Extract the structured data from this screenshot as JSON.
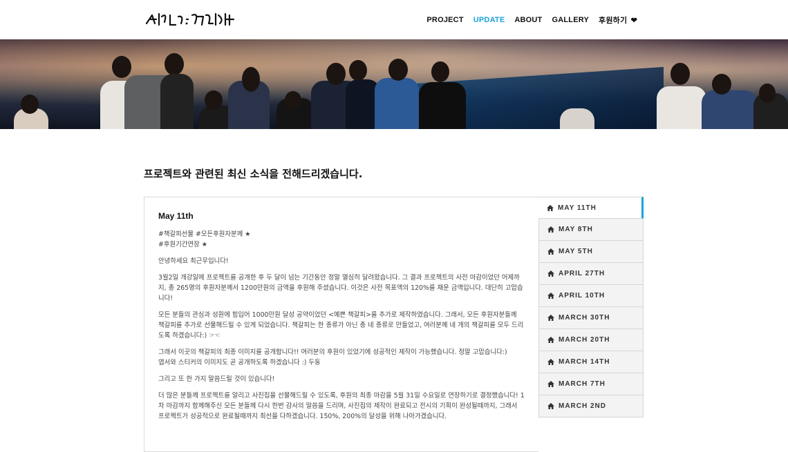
{
  "header": {
    "logo_alt": "서강대 · 고고기억해",
    "nav": [
      {
        "label": "PROJECT",
        "active": false
      },
      {
        "label": "UPDATE",
        "active": true
      },
      {
        "label": "ABOUT",
        "active": false
      },
      {
        "label": "GALLERY",
        "active": false
      },
      {
        "label": "후원하기",
        "active": false,
        "icon": "heart-icon"
      }
    ]
  },
  "page": {
    "title": "프로젝트와 관련된 최신 소식을 전해드리겠습니다."
  },
  "post": {
    "date": "May 11th",
    "paragraphs": [
      "#책갈피선물 #모든후원자분께 ★\n#후원기간연장 ★",
      "안녕하세요 최근우입니다!",
      "3월2일 개강일에 프로젝트를 공개한 후 두 달이 넘는 기간동안 정말 열심히 달려왔습니다. 그 결과 프로젝트의 사전 마감이었던 어제까지, 총 265명의 후원자분께서 1200만원의 금액을 후원해 주셨습니다. 이것은 사전 목표액의 120%를 채운 금액입니다. 대단히 고맙습니다!",
      "모든 분들의 관심과 성원에 힘입어 1000만원 달성 공약이었던 <예쁜 책갈피>를 추가로 제작하였습니다. 그래서, 모든 후원자분들께 책갈피를 추가로 선물해드릴 수 있게 되었습니다. 책갈피는 한 종류가 아닌 총 네 종류로 만들었고, 여러분께 네 개의 책갈피를 모두 드리도록 하겠습니다:) ☞☜",
      "그래서 이곳의 책갈피의 최종 이미지를 공개합니다!! 여러분의 후원이 있었기에 성공적인 제작이 가능했습니다. 정말 고맙습니다:)\n엽서와 스티커의 이미지도 곧 공개하도록 하겠습니다 :) 두둥",
      "그리고 또 한 가지 말씀드릴 것이 있습니다!",
      "더 많은 분들께 프로젝트를 알리고 사진집을 선물해드릴 수 있도록, 후원의 최종 마감을 5월 31일 수요일로 연장하기로 결정했습니다! 1차 마감까지 함께해주신 모든 분들께 다시 한번 감사의 말씀을 드리며, 사진집의 제작이 완료되고 전시의 기획이 완성될때까지, 그래서 프로젝트가 성공적으로 완료될때까지 최선을 다하겠습니다. 150%, 200%의 달성을 위해 나아가겠습니다."
    ]
  },
  "tabs": [
    {
      "label": "MAY 11TH",
      "active": true
    },
    {
      "label": "MAY 8TH",
      "active": false
    },
    {
      "label": "MAY 5TH",
      "active": false
    },
    {
      "label": "APRIL 27TH",
      "active": false
    },
    {
      "label": "APRIL 10TH",
      "active": false
    },
    {
      "label": "MARCH 30TH",
      "active": false
    },
    {
      "label": "MARCH 20TH",
      "active": false
    },
    {
      "label": "MARCH 14TH",
      "active": false
    },
    {
      "label": "MARCH 7TH",
      "active": false
    },
    {
      "label": "MARCH 2ND",
      "active": false
    }
  ],
  "colors": {
    "accent": "#1aa3d9",
    "tab_bg": "#f3f3f3"
  }
}
